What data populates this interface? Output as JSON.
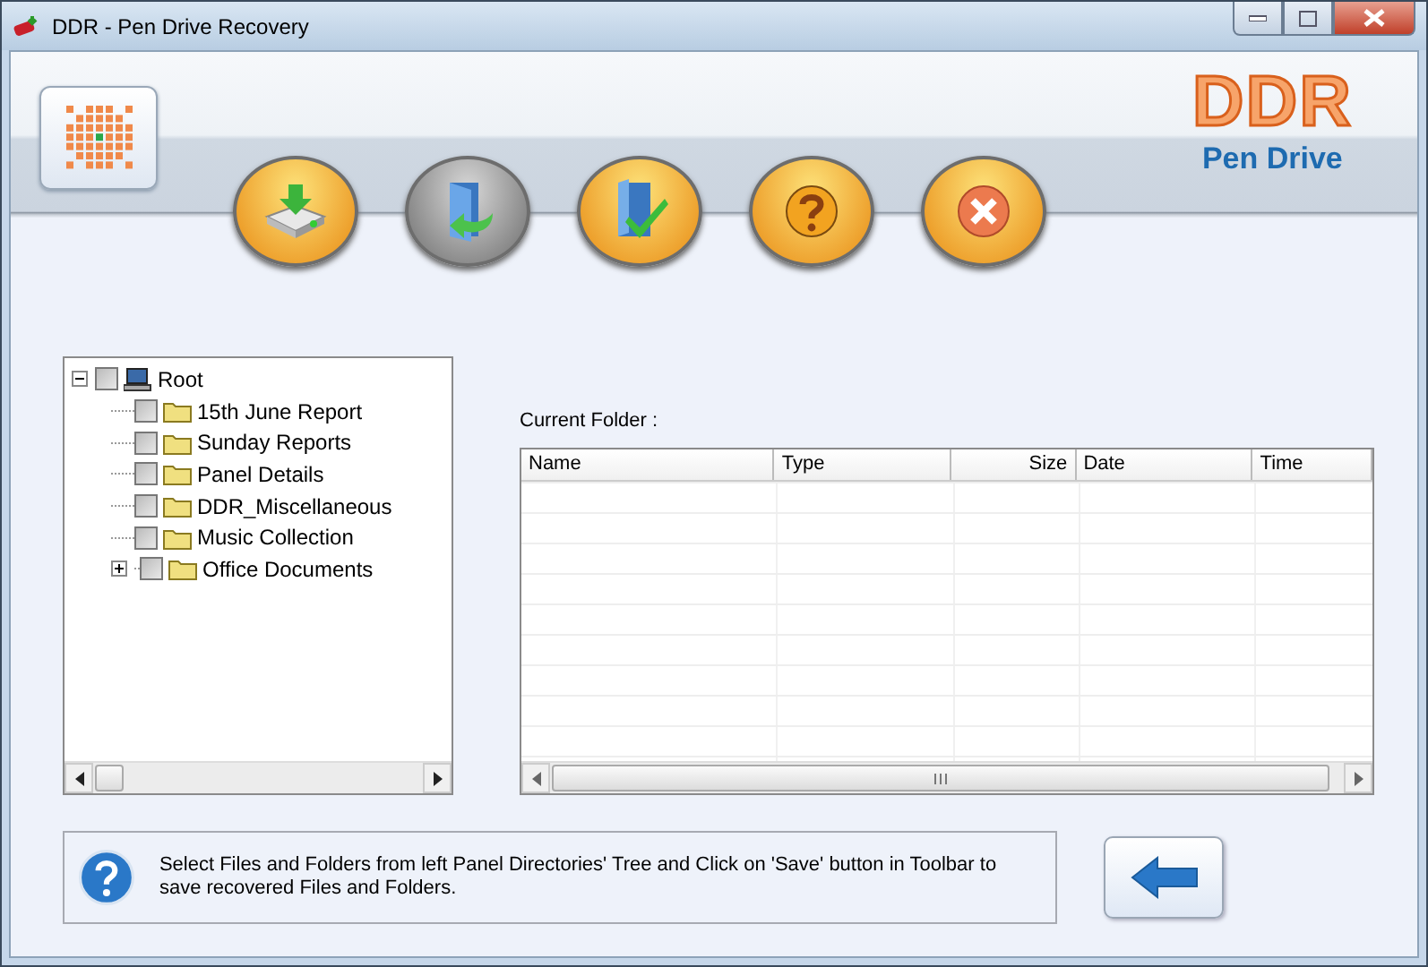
{
  "window": {
    "title": "DDR - Pen Drive Recovery"
  },
  "brand": {
    "name": "DDR",
    "product": "Pen Drive"
  },
  "toolbar": [
    {
      "kind": "open"
    },
    {
      "kind": "exit-door"
    },
    {
      "kind": "save"
    },
    {
      "kind": "help"
    },
    {
      "kind": "close"
    }
  ],
  "tree": {
    "label": "Root",
    "kind": "computer",
    "checked": false,
    "expanded": true,
    "children": [
      {
        "label": "15th June Report",
        "kind": "folder",
        "checked": false
      },
      {
        "label": "Sunday Reports",
        "kind": "folder",
        "checked": false
      },
      {
        "label": "Panel Details",
        "kind": "folder",
        "checked": false
      },
      {
        "label": "DDR_Miscellaneous",
        "kind": "folder",
        "checked": false
      },
      {
        "label": "Music Collection",
        "kind": "folder",
        "checked": false
      },
      {
        "label": "Office Documents",
        "kind": "folder",
        "checked": false,
        "expanded": false
      }
    ]
  },
  "current_folder": {
    "label": "Current Folder  :"
  },
  "table": {
    "columns": [
      {
        "label": "Name",
        "kind": "text"
      },
      {
        "label": "Type",
        "kind": "text"
      },
      {
        "label": "Size",
        "kind": "number"
      },
      {
        "label": "Date",
        "kind": "text"
      },
      {
        "label": "Time",
        "kind": "text"
      }
    ]
  },
  "info": {
    "text": "Select Files and Folders from left Panel Directories' Tree and Click on 'Save' button in Toolbar to save recovered Files and Folders."
  }
}
